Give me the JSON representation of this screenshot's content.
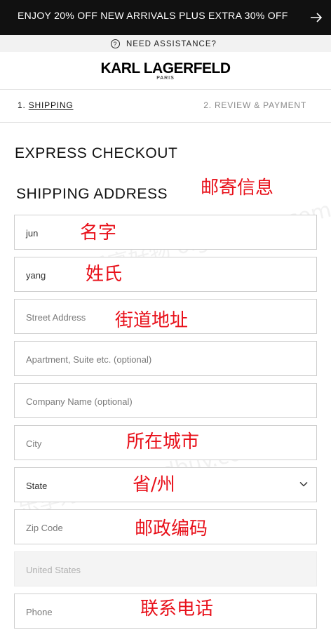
{
  "promo": {
    "text": "ENJOY 20% OFF NEW ARRIVALS PLUS EXTRA 30% OFF"
  },
  "assistance": {
    "icon": "?",
    "label": "NEED ASSISTANCE?"
  },
  "brand": {
    "name": "KARL LAGERFELD",
    "sub": "PARIS"
  },
  "steps": {
    "step1_num": "1.",
    "step1_label": "SHIPPING",
    "step2": "2. REVIEW & PAYMENT"
  },
  "headings": {
    "express": "EXPRESS CHECKOUT",
    "shipping": "SHIPPING ADDRESS"
  },
  "fields": {
    "first_name": "jun",
    "last_name": "yang",
    "street": "Street Address",
    "apartment": "Apartment, Suite etc. (optional)",
    "company": "Company Name (optional)",
    "city": "City",
    "state": "State",
    "zip": "Zip Code",
    "country": "United States",
    "phone": "Phone"
  },
  "annotations": {
    "shipping_info": "邮寄信息",
    "name": "名字",
    "surname": "姓氏",
    "street": "街道地址",
    "city": "所在城市",
    "state": "省/州",
    "zip": "邮政编码",
    "phone": "联系电话"
  },
  "watermark": {
    "text1": "乐享好物 olgoodbuy.com",
    "text2": "乐享好物 olgoodbuy.com"
  },
  "colors": {
    "promo_bg": "#111111",
    "annotation": "#e8101a",
    "border": "#cfcfcf"
  }
}
